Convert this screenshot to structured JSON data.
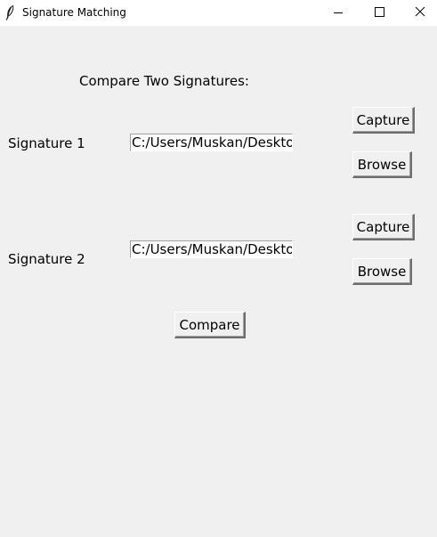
{
  "window": {
    "title": "Signature Matching",
    "icons": {
      "app": "feather-icon",
      "minimize": "minimize-icon",
      "maximize": "maximize-icon",
      "close": "close-icon"
    }
  },
  "main": {
    "heading": "Compare Two Signatures:",
    "signature1": {
      "label": "Signature 1",
      "path_value": "C:/Users/Muskan/Desktop",
      "capture_label": "Capture",
      "browse_label": "Browse"
    },
    "signature2": {
      "label": "Signature 2",
      "path_value": "C:/Users/Muskan/Desktop",
      "capture_label": "Capture",
      "browse_label": "Browse"
    },
    "compare_label": "Compare"
  }
}
